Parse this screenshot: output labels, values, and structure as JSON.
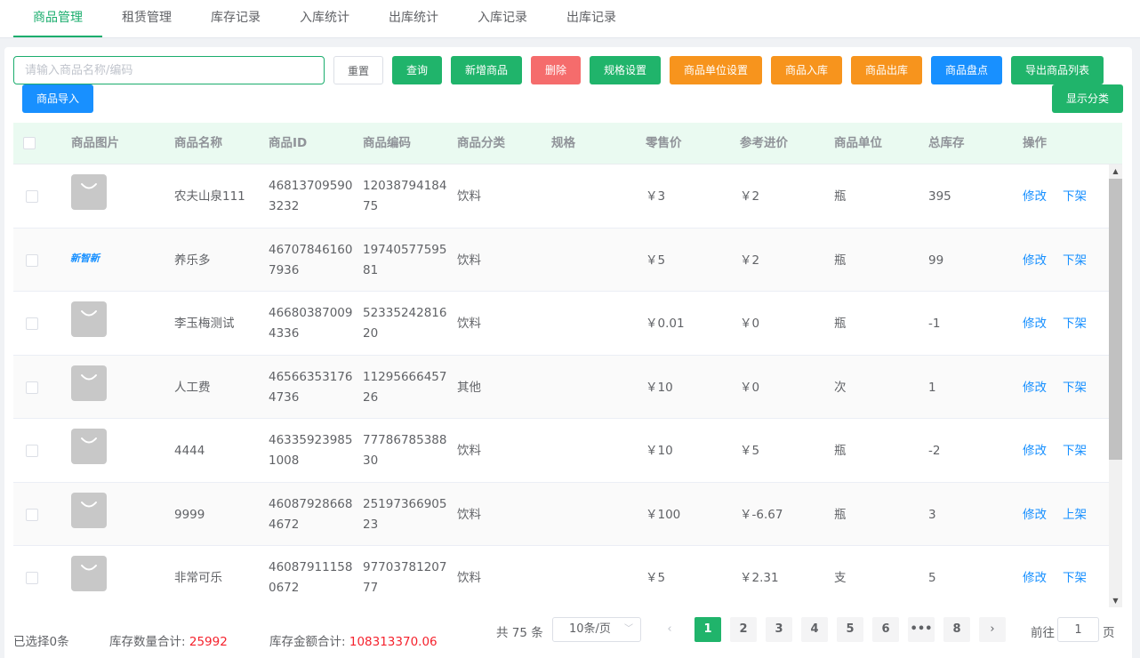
{
  "tabs": [
    "商品管理",
    "租赁管理",
    "库存记录",
    "入库统计",
    "出库统计",
    "入库记录",
    "出库记录"
  ],
  "search": {
    "placeholder": "请输入商品名称/编码",
    "value": ""
  },
  "toolbar": {
    "reset": "重置",
    "query": "查询",
    "add": "新增商品",
    "delete": "删除",
    "spec": "规格设置",
    "unit_setting": "商品单位设置",
    "stock_in": "商品入库",
    "stock_out": "商品出库",
    "inventory": "商品盘点",
    "export": "导出商品列表",
    "import": "商品导入",
    "show_category": "显示分类"
  },
  "table": {
    "headers": [
      "商品图片",
      "商品名称",
      "商品ID",
      "商品编码",
      "商品分类",
      "规格",
      "零售价",
      "参考进价",
      "商品单位",
      "总库存",
      "操作"
    ],
    "rows": [
      {
        "name": "农夫山泉111",
        "id1": "46813709590",
        "id2": "3232",
        "code1": "12038794184",
        "code2": "75",
        "category": "饮料",
        "spec": "",
        "retail": "￥3",
        "cost": "￥2",
        "unit": "瓶",
        "stock": "395",
        "edit": "修改",
        "shelf": "下架",
        "image": "placeholder"
      },
      {
        "name": "养乐多",
        "id1": "46707846160",
        "id2": "7936",
        "code1": "19740577595",
        "code2": "81",
        "category": "饮料",
        "spec": "",
        "retail": "￥5",
        "cost": "￥2",
        "unit": "瓶",
        "stock": "99",
        "edit": "修改",
        "shelf": "下架",
        "image": "logo",
        "logo_text": "新智新"
      },
      {
        "name": "李玉梅测试",
        "id1": "46680387009",
        "id2": "4336",
        "code1": "52335242816",
        "code2": "20",
        "category": "饮料",
        "spec": "",
        "retail": "￥0.01",
        "cost": "￥0",
        "unit": "瓶",
        "stock": "-1",
        "edit": "修改",
        "shelf": "下架",
        "image": "placeholder"
      },
      {
        "name": "人工费",
        "id1": "46566353176",
        "id2": "4736",
        "code1": "11295666457",
        "code2": "26",
        "category": "其他",
        "spec": "",
        "retail": "￥10",
        "cost": "￥0",
        "unit": "次",
        "stock": "1",
        "edit": "修改",
        "shelf": "下架",
        "image": "placeholder"
      },
      {
        "name": "4444",
        "id1": "46335923985",
        "id2": "1008",
        "code1": "77786785388",
        "code2": "30",
        "category": "饮料",
        "spec": "",
        "retail": "￥10",
        "cost": "￥5",
        "unit": "瓶",
        "stock": "-2",
        "edit": "修改",
        "shelf": "下架",
        "image": "placeholder"
      },
      {
        "name": "9999",
        "id1": "46087928668",
        "id2": "4672",
        "code1": "25197366905",
        "code2": "23",
        "category": "饮料",
        "spec": "",
        "retail": "￥100",
        "cost": "￥-6.67",
        "unit": "瓶",
        "stock": "3",
        "edit": "修改",
        "shelf": "上架",
        "image": "placeholder"
      },
      {
        "name": "非常可乐",
        "id1": "46087911158",
        "id2": "0672",
        "code1": "97703781207",
        "code2": "77",
        "category": "饮料",
        "spec": "",
        "retail": "￥5",
        "cost": "￥2.31",
        "unit": "支",
        "stock": "5",
        "edit": "修改",
        "shelf": "下架",
        "image": "placeholder"
      }
    ]
  },
  "footer": {
    "selected": "已选择0条",
    "qty_label": "库存数量合计:",
    "qty_value": "25992",
    "amount_label": "库存金额合计:",
    "amount_value": "108313370.06"
  },
  "pagination": {
    "total": "共 75 条",
    "page_size": "10条/页",
    "pages": [
      "1",
      "2",
      "3",
      "4",
      "5",
      "6",
      "•••",
      "8"
    ],
    "current": "1",
    "goto_label": "前往",
    "goto_value": "1",
    "page_suffix": "页"
  },
  "colors": {
    "primary_green": "#20b46b",
    "delete_red": "#f56c6c",
    "orange": "#f7941d",
    "blue": "#1890ff",
    "total_red": "#f5222d"
  }
}
